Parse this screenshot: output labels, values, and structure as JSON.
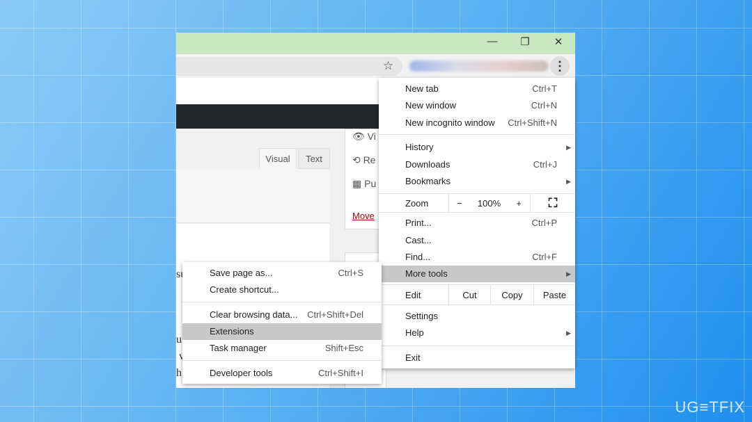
{
  "window": {
    "minimize": "—",
    "restore": "❐",
    "close": "✕"
  },
  "toolbar": {
    "star": "☆",
    "menu": "⋮"
  },
  "editor": {
    "tabs": [
      "Visual",
      "Text"
    ],
    "side_items": [
      "Vi",
      "Re",
      "Pu"
    ],
    "move_link": "Move",
    "text_fragments": [
      "su",
      "u",
      "v",
      "h"
    ]
  },
  "menu": {
    "items1": [
      {
        "label": "New tab",
        "shortcut": "Ctrl+T"
      },
      {
        "label": "New window",
        "shortcut": "Ctrl+N"
      },
      {
        "label": "New incognito window",
        "shortcut": "Ctrl+Shift+N"
      }
    ],
    "items2": [
      {
        "label": "History",
        "shortcut": ""
      },
      {
        "label": "Downloads",
        "shortcut": "Ctrl+J"
      },
      {
        "label": "Bookmarks",
        "shortcut": ""
      }
    ],
    "zoom": {
      "label": "Zoom",
      "minus": "−",
      "value": "100%",
      "plus": "+"
    },
    "items3": [
      {
        "label": "Print...",
        "shortcut": "Ctrl+P"
      },
      {
        "label": "Cast...",
        "shortcut": ""
      },
      {
        "label": "Find...",
        "shortcut": "Ctrl+F"
      },
      {
        "label": "More tools",
        "shortcut": ""
      }
    ],
    "edit": {
      "label": "Edit",
      "cut": "Cut",
      "copy": "Copy",
      "paste": "Paste"
    },
    "items4": [
      {
        "label": "Settings"
      },
      {
        "label": "Help"
      }
    ],
    "exit": "Exit"
  },
  "submenu": {
    "items": [
      {
        "label": "Save page as...",
        "shortcut": "Ctrl+S"
      },
      {
        "label": "Create shortcut...",
        "shortcut": ""
      },
      {
        "label": "Clear browsing data...",
        "shortcut": "Ctrl+Shift+Del"
      },
      {
        "label": "Extensions",
        "shortcut": ""
      },
      {
        "label": "Task manager",
        "shortcut": "Shift+Esc"
      },
      {
        "label": "Developer tools",
        "shortcut": "Ctrl+Shift+I"
      }
    ]
  },
  "watermark": "UG≡TFIX"
}
